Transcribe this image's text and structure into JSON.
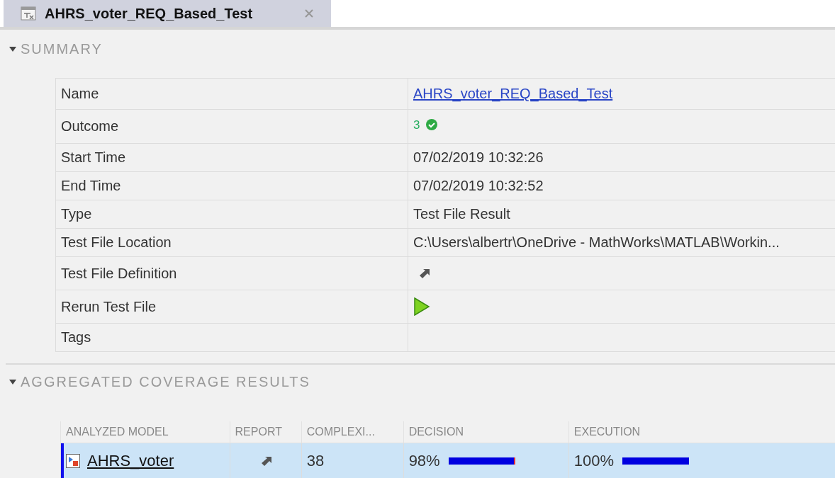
{
  "tab": {
    "title": "AHRS_voter_REQ_Based_Test",
    "selected": true
  },
  "summary": {
    "title": "SUMMARY",
    "expanded": true,
    "rows": [
      {
        "label": "Name",
        "kind": "link",
        "value": "AHRS_voter_REQ_Based_Test"
      },
      {
        "label": "Outcome",
        "kind": "outcome",
        "value": "3"
      },
      {
        "label": "Start Time",
        "kind": "text",
        "value": "07/02/2019 10:32:26"
      },
      {
        "label": "End Time",
        "kind": "text",
        "value": "07/02/2019 10:32:52"
      },
      {
        "label": "Type",
        "kind": "text",
        "value": "Test File Result"
      },
      {
        "label": "Test File Location",
        "kind": "text",
        "value": "C:\\Users\\albertr\\OneDrive - MathWorks\\MATLAB\\Workin..."
      },
      {
        "label": "Test File Definition",
        "kind": "open"
      },
      {
        "label": "Rerun Test File",
        "kind": "run"
      },
      {
        "label": "Tags",
        "kind": "empty"
      }
    ]
  },
  "coverage": {
    "title": "AGGREGATED COVERAGE RESULTS",
    "expanded": true,
    "columns": [
      "ANALYZED MODEL",
      "REPORT",
      "COMPLEXI...",
      "DECISION",
      "EXECUTION"
    ],
    "rows": [
      {
        "model": "AHRS_voter",
        "selected": true,
        "complexity": "38",
        "decision": {
          "reading": "98%",
          "level": 0.98
        },
        "execution": {
          "reading": "100%",
          "level": 1.0
        }
      }
    ]
  }
}
